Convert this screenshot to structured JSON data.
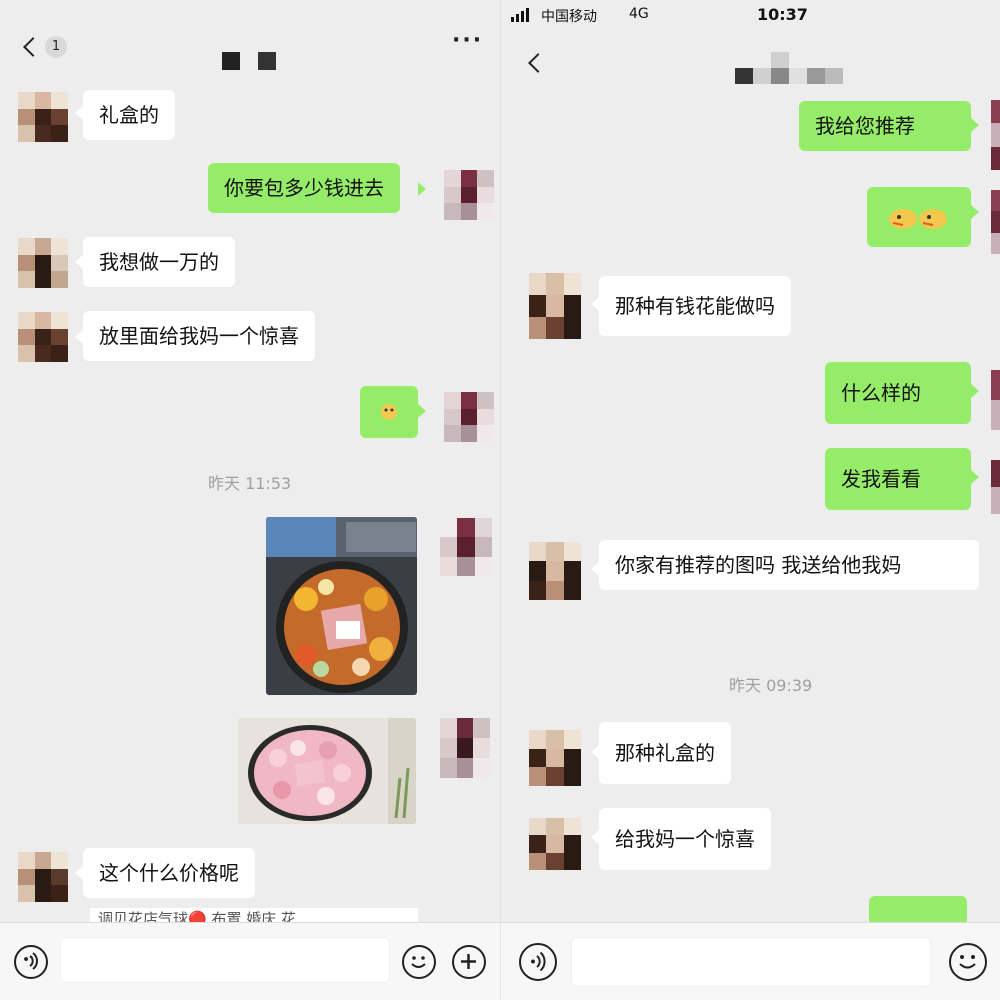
{
  "left": {
    "header": {
      "unread_badge": "1"
    },
    "messages": {
      "m1": "礼盒的",
      "m2": "你要包多少钱进去",
      "m3": "我想做一万的",
      "m4": "放里面给我妈一个惊喜",
      "m9": "这个什么价格呢"
    },
    "timestamp": "昨天 11:53",
    "link_preview_snippet": "调贝花店气球🔴 布置 婚庆 花"
  },
  "right": {
    "status_bar": {
      "carrier": "中国移动",
      "network": "4G",
      "time": "10:37"
    },
    "messages": {
      "r1": "我给您推荐",
      "r3": "那种有钱花能做吗",
      "r4": "什么样的",
      "r5": "发我看看",
      "r6": "你家有推荐的图吗 我送给他我妈",
      "r7": "那种礼盒的",
      "r8": "给我妈一个惊喜"
    },
    "timestamp": "昨天 09:39"
  },
  "colors": {
    "outgoing": "#95ec69",
    "incoming": "#ffffff",
    "background": "#ededed"
  },
  "icons": [
    "back-chevron-icon",
    "more-dots-icon",
    "voice-icon",
    "emoji-icon",
    "plus-icon",
    "signal-icon"
  ]
}
